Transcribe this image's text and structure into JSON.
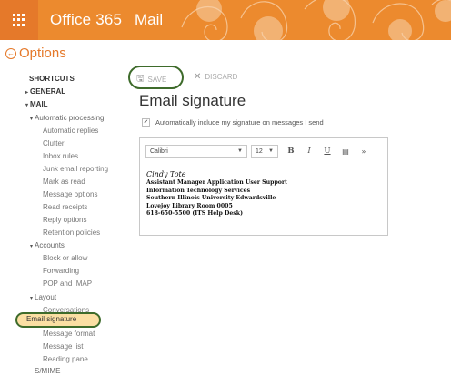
{
  "header": {
    "brand": "Office 365",
    "app": "Mail",
    "accent": "#ec8a2e"
  },
  "options": {
    "title": "Options",
    "back_icon": "back-arrow-circle-icon"
  },
  "nav": {
    "shortcuts": "SHORTCUTS",
    "general": "GENERAL",
    "mail": "MAIL",
    "automatic_processing": "Automatic processing",
    "automatic_replies": "Automatic replies",
    "clutter": "Clutter",
    "inbox_rules": "Inbox rules",
    "junk_email_reporting": "Junk email reporting",
    "mark_as_read": "Mark as read",
    "message_options": "Message options",
    "read_receipts": "Read receipts",
    "reply_options": "Reply options",
    "retention_policies": "Retention policies",
    "accounts": "Accounts",
    "block_or_allow": "Block or allow",
    "forwarding": "Forwarding",
    "pop_and_imap": "POP and IMAP",
    "layout": "Layout",
    "conversations": "Conversations",
    "email_signature": "Email signature",
    "message_format": "Message format",
    "message_list": "Message list",
    "reading_pane": "Reading pane",
    "smime": "S/MIME"
  },
  "toolbar": {
    "save": "SAVE",
    "discard": "DISCARD"
  },
  "content": {
    "title": "Email signature",
    "auto_include_label": "Automatically include my signature on messages I send",
    "auto_include_checked": true
  },
  "editor": {
    "font": "Calibri",
    "size": "12",
    "bold": "B",
    "italic": "I",
    "underline": "U"
  },
  "signature": {
    "name": "Cindy Tote",
    "title": "Assistant Manager Application User Support",
    "dept": "Information Technology Services",
    "university": "Southern Illinois University Edwardsville",
    "room": "Lovejoy Library Room 0005",
    "phone": "618-650-5500 (ITS Help Desk)"
  }
}
